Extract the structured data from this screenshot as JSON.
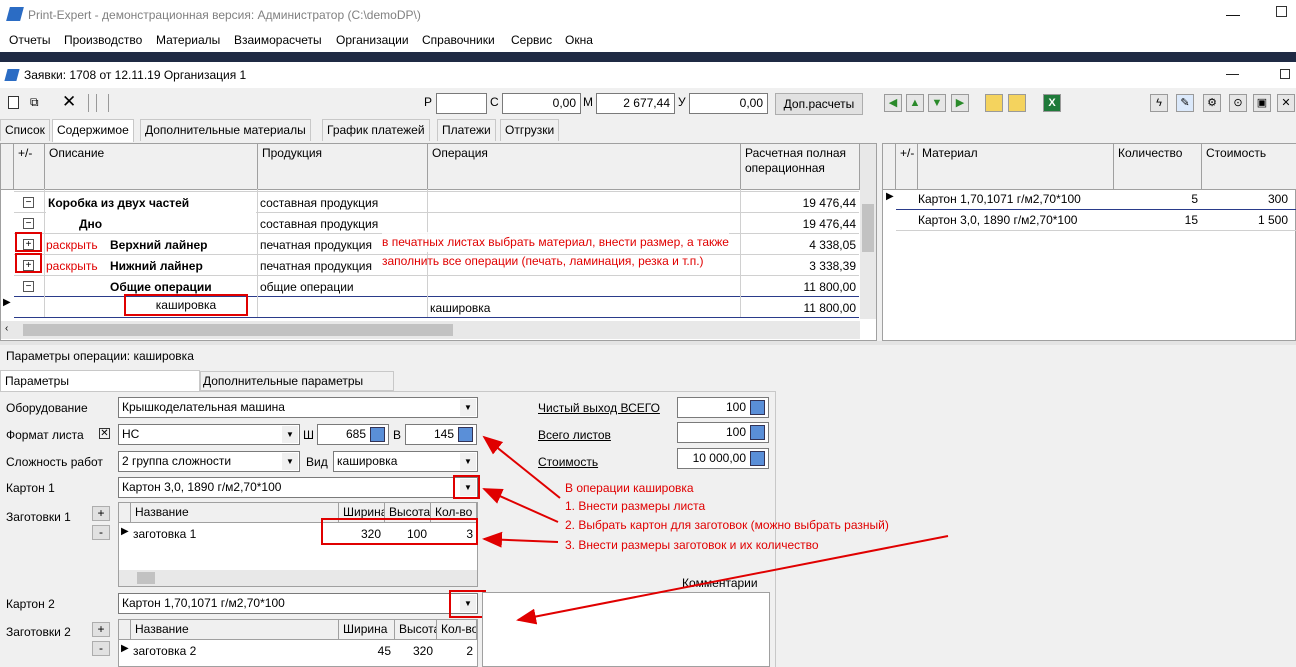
{
  "window": {
    "title": "Print-Expert - демонстрационная версия: Администратор (C:\\demoDP\\)"
  },
  "menu": [
    "Отчеты",
    "Производство",
    "Материалы",
    "Взаиморасчеты",
    "Организации",
    "Справочники",
    "Сервис",
    "Окна"
  ],
  "doc": {
    "title": "Заявки: 1708 от 12.11.19  Организация 1"
  },
  "toolbar": {
    "r_label": "Р",
    "r_value": "",
    "c_label": "С",
    "c_value": "0,00",
    "m_label": "М",
    "m_value": "2 677,44",
    "u_label": "У",
    "u_value": "0,00",
    "extra_button": "Доп.расчеты"
  },
  "tabs": [
    "Список",
    "Содержимое",
    "Дополнительные материалы",
    "График платежей",
    "Платежи",
    "Отгрузки"
  ],
  "main_grid": {
    "headers": {
      "plusminus": "+/-",
      "desc": "Описание",
      "product": "Продукция",
      "operation": "Операция",
      "cost": "Расчетная полная операционная"
    },
    "rows": [
      {
        "sign": "−",
        "desc": "Коробка из двух частей",
        "product": "составная продукция",
        "operation": "",
        "cost": "19 476,44"
      },
      {
        "sign": "−",
        "desc": "Дно",
        "product": "составная продукция",
        "operation": "",
        "cost": "19 476,44"
      },
      {
        "sign": "+",
        "desc": "Верхний лайнер",
        "product": "печатная продукция",
        "operation": "",
        "cost": "4 338,05",
        "note": "раскрыть"
      },
      {
        "sign": "+",
        "desc": "Нижний лайнер",
        "product": "печатная продукция",
        "operation": "",
        "cost": "3 338,39",
        "note": "раскрыть"
      },
      {
        "sign": "−",
        "desc": "Общие операции",
        "product": "общие операции",
        "operation": "",
        "cost": "11 800,00"
      },
      {
        "sign": "",
        "desc": "кашировка",
        "product": "",
        "operation": "кашировка",
        "cost": "11 800,00"
      }
    ],
    "annotation": [
      "в печатных листах выбрать материал, внести размер, а также",
      "заполнить все операции (печать, ламинация, резка и т.п.)"
    ]
  },
  "material_grid": {
    "headers": {
      "plusminus": "+/-",
      "material": "Материал",
      "qty": "Количество",
      "cost": "Стоимость"
    },
    "rows": [
      {
        "material": "Картон 1,70,1071 г/м2,70*100",
        "qty": "5",
        "cost": "300"
      },
      {
        "material": "Картон 3,0, 1890 г/м2,70*100",
        "qty": "15",
        "cost": "1 500"
      }
    ]
  },
  "params": {
    "title": "Параметры операции: кашировка",
    "tabs": [
      "Параметры",
      "Дополнительные параметры"
    ],
    "equipment_label": "Оборудование",
    "equipment": "Крышкоделательная машина",
    "format_label": "Формат листа",
    "format": "НС",
    "w_label": "Ш",
    "w": "685",
    "h_label": "В",
    "h": "145",
    "complexity_label": "Сложность работ",
    "complexity": "2 группа сложности",
    "type_label": "Вид",
    "type": "кашировка",
    "carton1_label": "Картон 1",
    "carton1": "Картон 3,0, 1890 г/м2,70*100",
    "blanks1_label": "Заготовки 1",
    "blanks_headers": {
      "name": "Название",
      "width": "Ширина",
      "height": "Высота",
      "count": "Кол-во"
    },
    "blanks1": [
      {
        "name": "заготовка 1",
        "width": "320",
        "height": "100",
        "count": "3"
      }
    ],
    "carton2_label": "Картон 2",
    "carton2": "Картон 1,70,1071 г/м2,70*100",
    "blanks2_label": "Заготовки 2",
    "blanks2": [
      {
        "name": "заготовка 2",
        "width": "45",
        "height": "320",
        "count": "2"
      }
    ],
    "net_label": "Чистый выход ВСЕГО",
    "net": "100",
    "sheets_label": "Всего листов",
    "sheets": "100",
    "cost_label": "Стоимость",
    "cost": "10 000,00",
    "comments_label": "Комментарии"
  },
  "instructions": [
    "В операции кашировка",
    "1. Внести размеры листа",
    "2. Выбрать картон для заготовок (можно выбрать разный)",
    "3. Внести размеры заготовок и их количество"
  ],
  "colors": {
    "annotation": "#e00000",
    "titlebar_dark": "#1f2a44"
  }
}
